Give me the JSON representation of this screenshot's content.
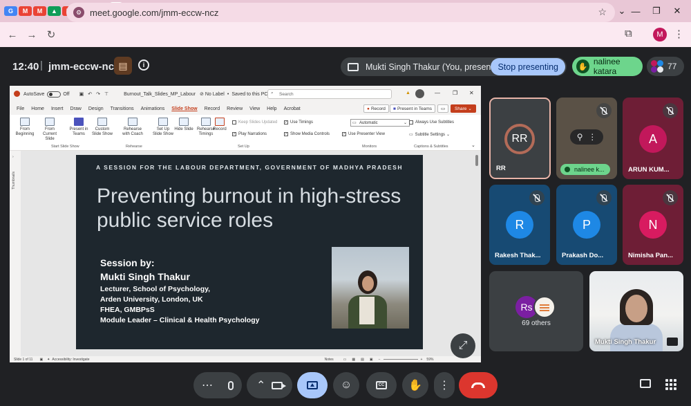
{
  "browser": {
    "url": "meet.google.com/jmm-eccw-ncz",
    "profile_initial": "M",
    "tab_icons": [
      {
        "label": "G",
        "color": "#4285f4"
      },
      {
        "label": "M",
        "color": "#ea4335"
      },
      {
        "label": "M",
        "color": "#ea4335"
      },
      {
        "label": "▲",
        "color": "#0f9d58"
      },
      {
        "label": "M",
        "color": "#ea4335"
      },
      {
        "label": "▤",
        "color": "#4285f4"
      },
      {
        "label": "G",
        "color": "#4285f4"
      }
    ],
    "tab_icons_right": [
      {
        "label": "M",
        "color": "#ea4335"
      },
      {
        "label": "G",
        "color": "#4285f4"
      },
      {
        "label": "G",
        "color": "#4285f4"
      },
      {
        "label": "⋯",
        "color": "#f4b400"
      },
      {
        "label": "◉",
        "color": "#5b3fd1"
      },
      {
        "label": "M",
        "color": "#ea4335"
      },
      {
        "label": "▶",
        "color": "#ff0000"
      },
      {
        "label": "▣",
        "color": "#ff0000"
      },
      {
        "label": "◈",
        "color": "#db4437"
      },
      {
        "label": "◍",
        "color": "#5f6368"
      },
      {
        "label": "◐",
        "color": "#1a73e8"
      },
      {
        "label": "G",
        "color": "#4285f4"
      },
      {
        "label": "G",
        "color": "#4285f4"
      },
      {
        "label": "G",
        "color": "#4285f4"
      },
      {
        "label": "◎",
        "color": "#1a73e8"
      },
      {
        "label": "W",
        "color": "#c62828"
      },
      {
        "label": "G",
        "color": "#4285f4"
      },
      {
        "label": "◆",
        "color": "#1a3c8c"
      },
      {
        "label": "◆",
        "color": "#1a3c8c"
      },
      {
        "label": "▯",
        "color": "#555555"
      },
      {
        "label": "G",
        "color": "#4285f4"
      },
      {
        "label": "G",
        "color": "#4285f4"
      },
      {
        "label": "◎",
        "color": "#1a73e8"
      },
      {
        "label": "G",
        "color": "#4285f4"
      },
      {
        "label": "A",
        "color": "#1c2a4a"
      },
      {
        "label": "G",
        "color": "#4285f4"
      },
      {
        "label": "▶",
        "color": "#ff0000"
      },
      {
        "label": "G",
        "color": "#4285f4"
      }
    ]
  },
  "meet": {
    "time": "12:40",
    "separator": "|",
    "code": "jmm-eccw-ncz",
    "presenting_text": "Mukti Singh Thakur (You, presenting)",
    "stop_presenting": "Stop presenting",
    "raised_hand_name": "nalinee katara",
    "participant_count": "77"
  },
  "ppt": {
    "autosave": "AutoSave",
    "toggle_state": "Off",
    "filename": "Burnout_Talk_Slides_MP_Labour",
    "label": "No Label",
    "saved": "Saved to this PC",
    "search_placeholder": "Search",
    "menu": [
      "File",
      "Home",
      "Insert",
      "Draw",
      "Design",
      "Transitions",
      "Animations",
      "Slide Show",
      "Record",
      "Review",
      "View",
      "Help",
      "Acrobat"
    ],
    "active_menu": "Slide Show",
    "record_btn": "Record",
    "present_teams_btn": "Present in Teams",
    "share_btn": "Share",
    "ribbon": {
      "from_beginning": "From Beginning",
      "from_current": "From Current Slide",
      "present_teams": "Present in Teams",
      "custom_show": "Custom Slide Show",
      "rehearse_coach": "Rehearse with Coach",
      "setup_show": "Set Up Slide Show",
      "hide_slide": "Hide Slide",
      "rehearse_timings": "Rehearse Timings",
      "record": "Record",
      "keep_updated": "Keep Slides Updated",
      "play_narrations": "Play Narrations",
      "use_timings": "Use Timings",
      "show_media": "Show Media Controls",
      "monitor_value": "Automatic",
      "use_presenter_view": "Use Presenter View",
      "always_subtitles": "Always Use Subtitles",
      "subtitle_settings": "Subtitle Settings",
      "group_start": "Start Slide Show",
      "group_rehearse": "Rehearse",
      "group_setup": "Set Up",
      "group_monitors": "Monitors",
      "group_captions": "Captions & Subtitles"
    },
    "thumbnails_label": "Thumbnails",
    "status_slide": "Slide 1 of 11",
    "status_access": "Accessibility: Investigate",
    "status_notes": "Notes",
    "status_zoom": "59%"
  },
  "slide": {
    "subtitle": "A SESSION FOR THE LABOUR DEPARTMENT, GOVERNMENT OF MADHYA PRADESH",
    "title": "Preventing burnout in high-stress public service roles",
    "session_by": "Session by:",
    "name": "Mukti Singh Thakur",
    "lines": [
      "Lecturer, School of Psychology,",
      "Arden University, London, UK",
      "FHEA, GMBPsS",
      "Module Leader – Clinical & Health Psychology"
    ]
  },
  "tiles": {
    "rr": {
      "initials": "RR",
      "name": "RR",
      "color": "#7b4b3c"
    },
    "nalinee": {
      "name": "nalinee k..."
    },
    "arun": {
      "initial": "A",
      "name": "ARUN KUM...",
      "color": "#c2185b"
    },
    "rakesh": {
      "initial": "R",
      "name": "Rakesh Thak...",
      "color": "#1e88e5"
    },
    "prakash": {
      "initial": "P",
      "name": "Prakash Do...",
      "color": "#1e88e5"
    },
    "nimisha": {
      "initial": "N",
      "name": "Nimisha Pan...",
      "color": "#d81b60"
    },
    "others": {
      "initials": "Rs",
      "label": "69 others"
    },
    "self": {
      "name": "Mukti Singh Thakur"
    }
  },
  "colors": {
    "accent": "#a8c7fa",
    "hand": "#6dd58c",
    "end_call": "#dc362e"
  }
}
